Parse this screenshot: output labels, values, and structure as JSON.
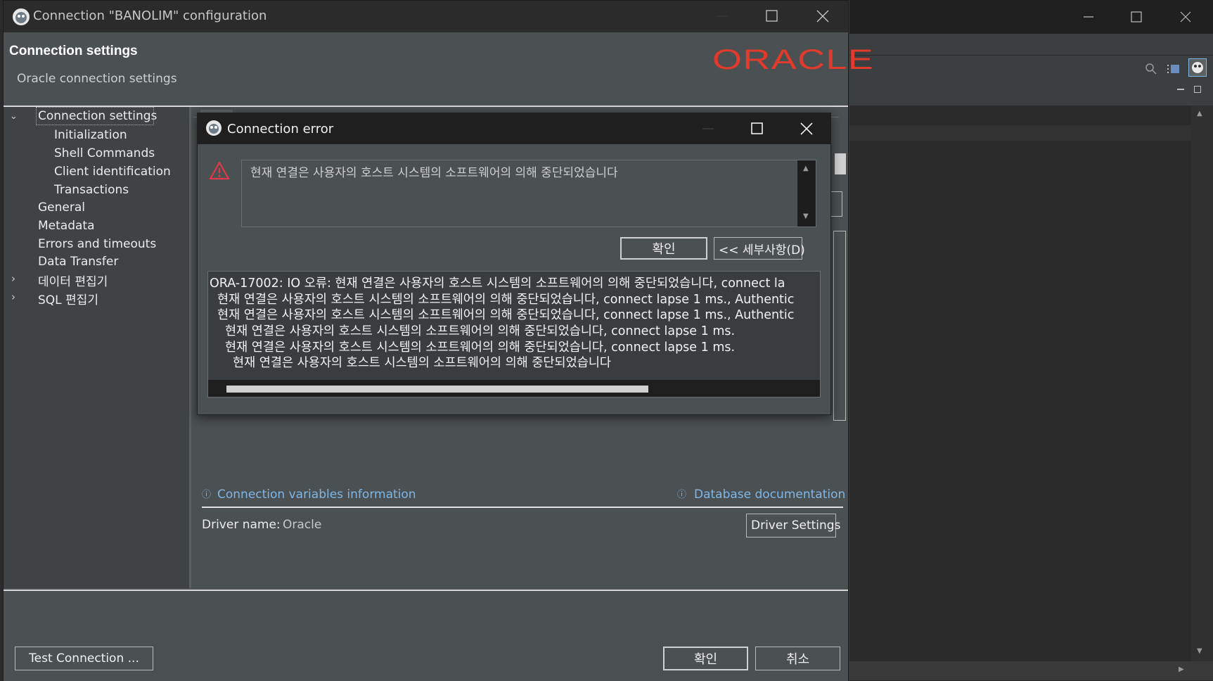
{
  "main_window": {
    "title": "Connection \"BANOLIM\" configuration",
    "header_title": "Connection settings",
    "header_subtitle": "Oracle connection settings",
    "logo_text": "ORACLE",
    "tree": [
      {
        "label": "Connection settings",
        "level": 0,
        "expanded": true,
        "selected": true
      },
      {
        "label": "Initialization",
        "level": 1
      },
      {
        "label": "Shell Commands",
        "level": 1
      },
      {
        "label": "Client identification",
        "level": 1
      },
      {
        "label": "Transactions",
        "level": 1
      },
      {
        "label": "General",
        "level": 0
      },
      {
        "label": "Metadata",
        "level": 0
      },
      {
        "label": "Errors and timeouts",
        "level": 0
      },
      {
        "label": "Data Transfer",
        "level": 0
      },
      {
        "label": "데이터 편집기",
        "level": 0,
        "collapsed": true
      },
      {
        "label": "SQL 편집기",
        "level": 0,
        "collapsed": true
      }
    ],
    "connection_variables_link": "Connection variables information",
    "database_docs_link": "Database documentation",
    "driver_name_label": "Driver name:",
    "driver_name_value": "Oracle",
    "driver_settings_button": "Driver Settings",
    "test_connection_button": "Test Connection ...",
    "ok_button": "확인",
    "cancel_button": "취소"
  },
  "error_dialog": {
    "title": "Connection error",
    "message": "현재 연결은 사용자의 호스트 시스템의 소프트웨어의 의해 중단되었습니다",
    "ok_button": "확인",
    "details_button": "<< 세부사항(D)",
    "details_lines": [
      "ORA-17002: IO 오류: 현재 연결은 사용자의 호스트 시스템의 소프트웨어의 의해 중단되었습니다, connect la",
      "현재 연결은 사용자의 호스트 시스템의 소프트웨어의 의해 중단되었습니다, connect lapse 1 ms., Authentic",
      "현재 연결은 사용자의 호스트 시스템의 소프트웨어의 의해 중단되었습니다, connect lapse 1 ms., Authentic",
      "현재 연결은 사용자의 호스트 시스템의 소프트웨어의 의해 중단되었습니다, connect lapse 1 ms.",
      "현재 연결은 사용자의 호스트 시스템의 소프트웨어의 의해 중단되었습니다, connect lapse 1 ms.",
      "현재 연결은 사용자의 호스트 시스템의 소프트웨어의 의해 중단되었습니다"
    ]
  },
  "colors": {
    "window_bg": "#4b5052",
    "titlebar_bg": "#2b2b2b",
    "accent_link": "#7fb6e6",
    "oracle_red": "#e23a2b",
    "warning_red": "#e0394b"
  }
}
